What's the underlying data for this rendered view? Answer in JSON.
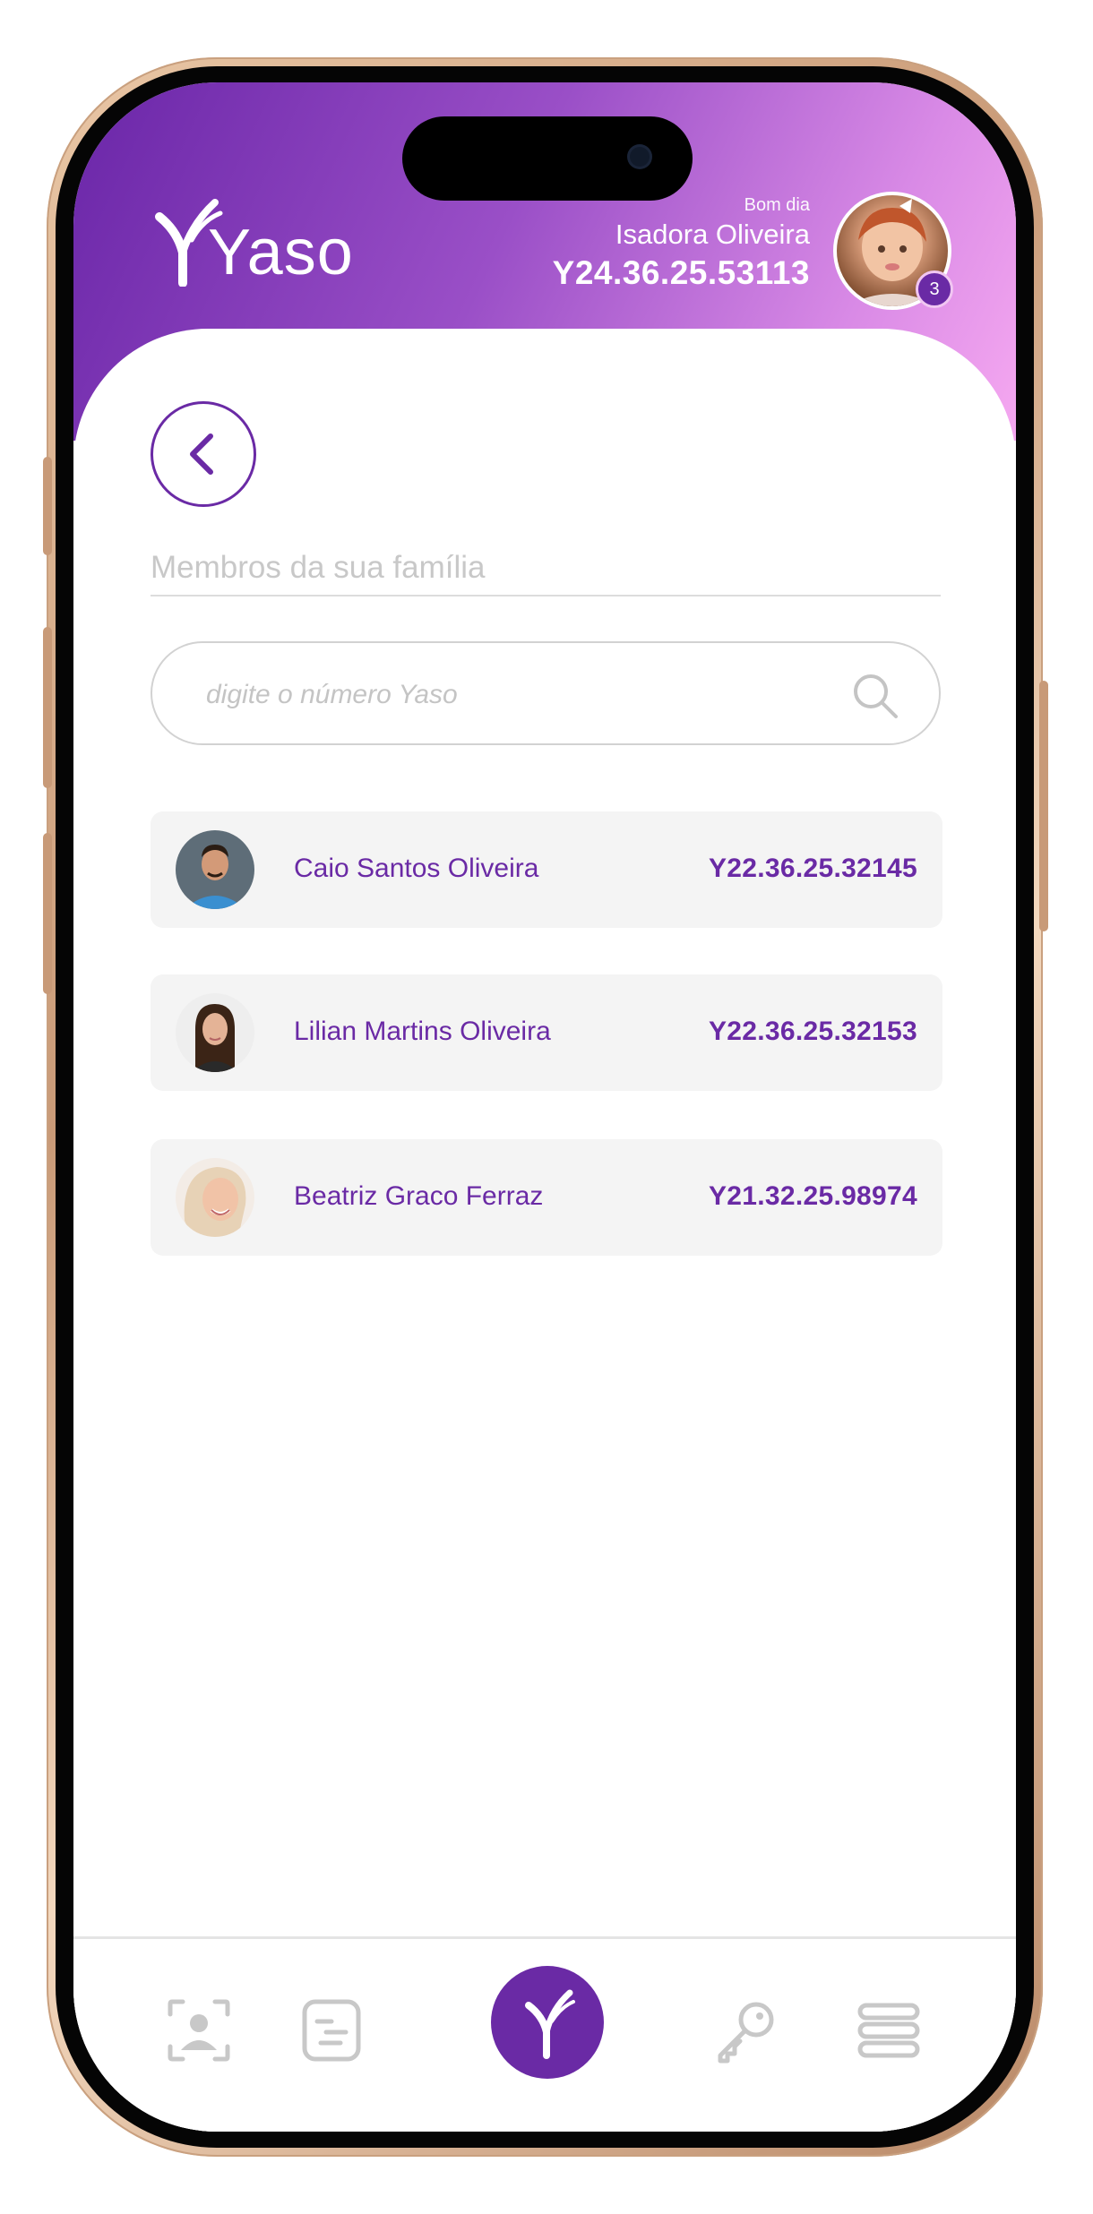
{
  "header": {
    "brand": "Yaso",
    "greeting": "Bom dia",
    "user_name": "Isadora Oliveira",
    "user_id": "Y24.36.25.53113",
    "notification_count": "3"
  },
  "main": {
    "section_title": "Membros da sua família",
    "search_placeholder": "digite o número Yaso",
    "members": [
      {
        "name": "Caio Santos Oliveira",
        "id": "Y22.36.25.32145"
      },
      {
        "name": "Lilian Martins Oliveira",
        "id": "Y22.36.25.32153"
      },
      {
        "name": "Beatriz Graco Ferraz",
        "id": "Y21.32.25.98974"
      }
    ]
  },
  "nav": {
    "items": [
      {
        "icon": "face-scan-icon"
      },
      {
        "icon": "document-icon"
      },
      {
        "icon": "yaso-home-icon"
      },
      {
        "icon": "key-icon"
      },
      {
        "icon": "menu-icon"
      }
    ]
  },
  "colors": {
    "accent": "#6a2aa5",
    "header_gradient_start": "#6a26a8",
    "header_gradient_end": "#f5a8f0"
  }
}
